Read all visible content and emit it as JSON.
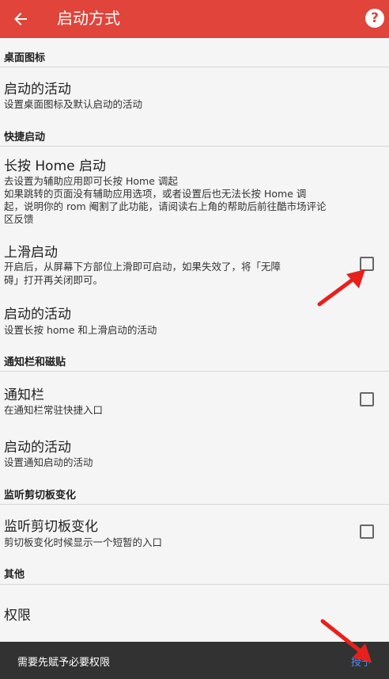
{
  "appbar": {
    "title": "启动方式",
    "back_icon": "arrow-left-icon",
    "help_icon": "help-circle-icon",
    "help_glyph": "?"
  },
  "sections": {
    "desktop_icon": {
      "header": "桌面图标",
      "launch_activity": {
        "title": "启动的活动",
        "summary": "设置桌面图标及默认启动的活动"
      }
    },
    "shortcut": {
      "header": "快捷启动",
      "long_press_home": {
        "title": "长按 Home 启动",
        "summary_1": "去设置为辅助应用即可长按 Home 调起",
        "summary_2": "如果跳转的页面没有辅助应用选项，或者设置后也无法长按 Home 调",
        "summary_3": "起，说明你的 rom 阉割了此功能，请阅读右上角的帮助后前往酷市场评论",
        "summary_4": "区反馈"
      },
      "swipe_up": {
        "title": "上滑启动",
        "summary_1": "开启后，从屏幕下方部位上滑即可启动，如果失效了，将「无障",
        "summary_2": "碍」打开再关闭即可。",
        "checked": false
      },
      "launch_activity": {
        "title": "启动的活动",
        "summary": "设置长按 home 和上滑启动的活动"
      }
    },
    "notification": {
      "header": "通知栏和磁贴",
      "notification_bar": {
        "title": "通知栏",
        "summary": "在通知栏常驻快捷入口",
        "checked": false
      },
      "launch_activity": {
        "title": "启动的活动",
        "summary": "设置通知启动的活动"
      }
    },
    "clipboard": {
      "header": "监听剪切板变化",
      "listen": {
        "title": "监听剪切板变化",
        "summary": "剪切板变化时候显示一个短暂的入口",
        "checked": false
      }
    },
    "other": {
      "header": "其他",
      "permission": {
        "title": "权限"
      }
    }
  },
  "snackbar": {
    "message": "需要先赋予必要权限",
    "action": "授予"
  },
  "colors": {
    "appbar": "#e0443a",
    "snackbar": "#323232",
    "action": "#4f8ef7",
    "annotation_arrow": "#e8201c"
  }
}
